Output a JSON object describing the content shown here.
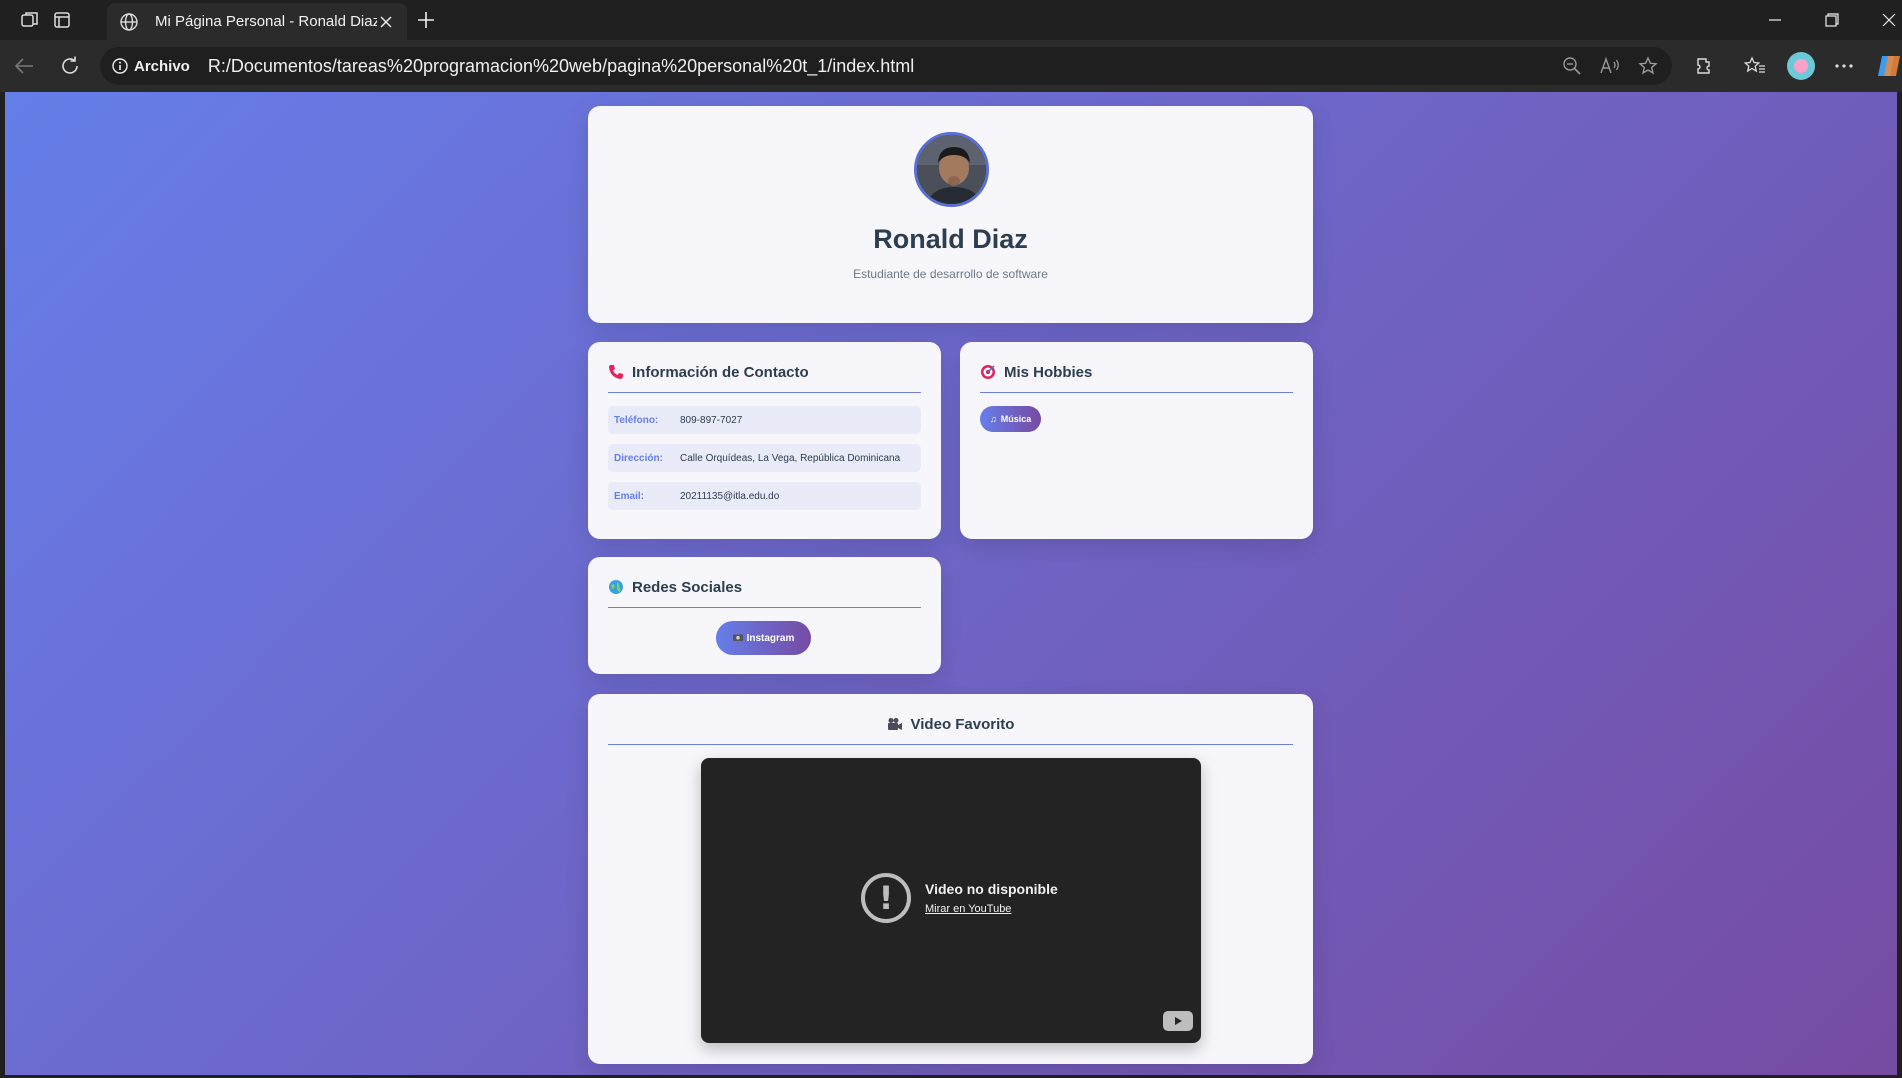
{
  "browser": {
    "tab_title": "Mi Página Personal - Ronald Diaz",
    "site_info_label": "Archivo",
    "url": "R:/Documentos/tareas%20programacion%20web/pagina%20personal%20t_1/index.html"
  },
  "header": {
    "name": "Ronald Diaz",
    "subtitle": "Estudiante de desarrollo de software"
  },
  "contact": {
    "title": "Información de Contacto",
    "rows": [
      {
        "label": "Teléfono:",
        "value": "809-897-7027"
      },
      {
        "label": "Dirección:",
        "value": "Calle Orquídeas, La Vega, República Dominicana"
      },
      {
        "label": "Email:",
        "value": "20211135@itla.edu.do"
      }
    ]
  },
  "hobbies": {
    "title": "Mis Hobbies",
    "items": [
      {
        "label": "Música"
      }
    ]
  },
  "social": {
    "title": "Redes Sociales",
    "instagram_label": "Instagram"
  },
  "video": {
    "title": "Video Favorito",
    "unavailable_title": "Video no disponible",
    "watch_link": "Mirar en YouTube"
  },
  "colors": {
    "gradient_start": "#667eea",
    "gradient_end": "#764ba2",
    "card_bg": "#f7f7fb",
    "heading": "#2c3e50"
  }
}
